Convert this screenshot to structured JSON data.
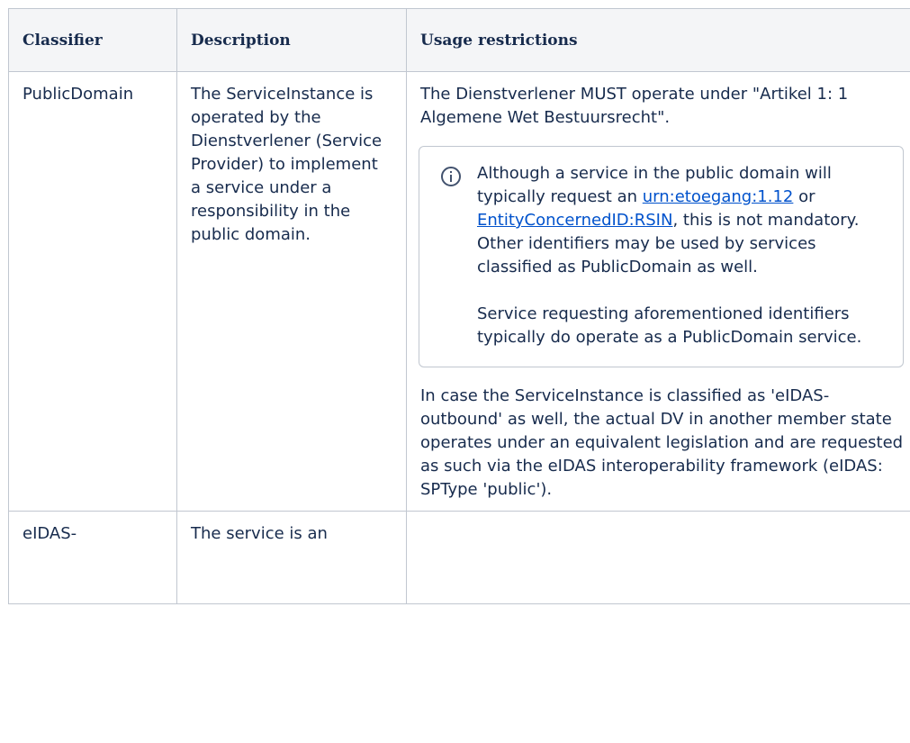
{
  "table": {
    "headers": {
      "classifier": "Classifier",
      "description": "Description",
      "usage": "Usage restrictions"
    },
    "row1": {
      "classifier": "PublicDomain",
      "description": "The ServiceInstance is operated by the Dienstverlener (Service Provider) to implement a service under a responsibility in the public domain.",
      "usage_intro": "The Dienstverlener MUST operate under \"Artikel 1: 1 Algemene Wet Bestuursrecht\".",
      "info_panel": {
        "icon": "info-icon",
        "p1_before_link1": "Although a service in the public domain will typically request an ",
        "link1": "urn:etoegang:1.12",
        "p1_between": " or ",
        "link2": "EntityConcernedID:RSIN",
        "p1_after": ", this is not mandatory. Other identifiers may be used by services classified as PublicDomain as well.",
        "p2": "Service requesting aforementioned identifiers typically do operate as a PublicDomain service."
      },
      "usage_outro": "In case the ServiceInstance is classified as 'eIDAS-outbound' as well, the actual DV in another member state operates under an equivalent legislation and are requested as such via the eIDAS interoperability framework (eIDAS: SPType 'public')."
    },
    "row2": {
      "classifier": "eIDAS-",
      "description": "The service is an",
      "usage": ""
    }
  },
  "colors": {
    "text": "#172b4d",
    "link": "#0052cc",
    "border": "#c1c7d0",
    "header_bg": "#f4f5f7"
  }
}
